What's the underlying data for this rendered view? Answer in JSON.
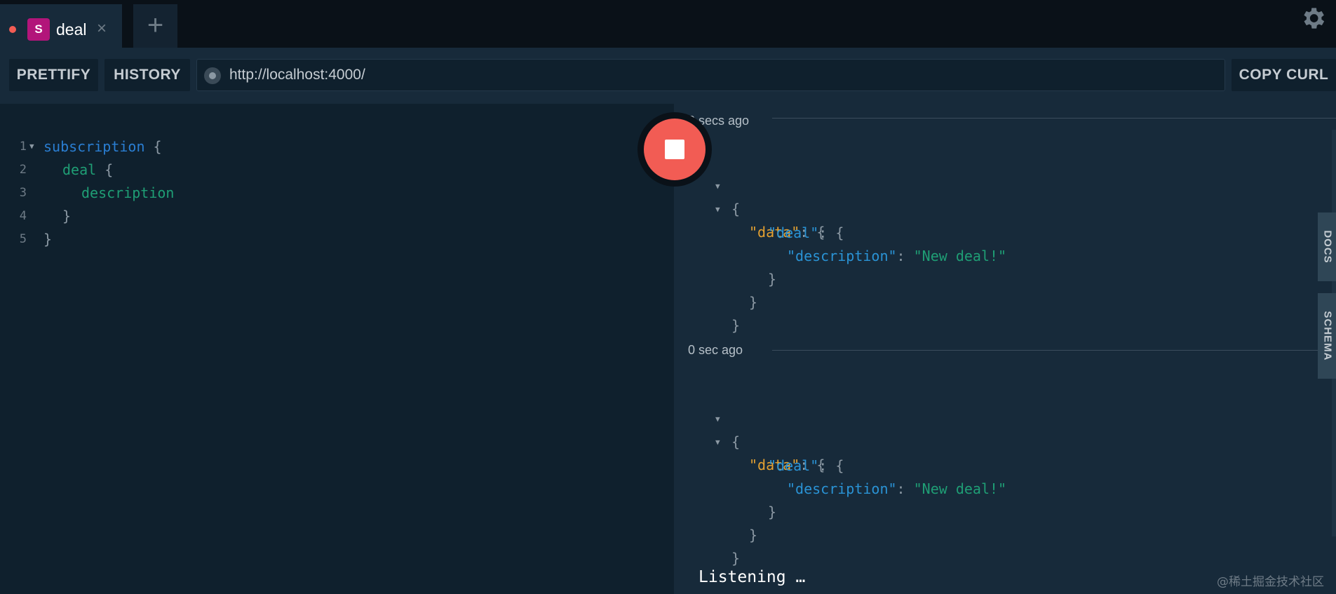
{
  "tabs": [
    {
      "badge": "S",
      "label": "deal",
      "close": "×"
    }
  ],
  "tab_add": "+",
  "icons": {
    "settings": "gear-icon",
    "close": "close-icon",
    "add": "plus-icon",
    "stop": "stop-icon"
  },
  "toolbar": {
    "prettify_label": "PRETTIFY",
    "history_label": "HISTORY",
    "url": "http://localhost:4000/",
    "copy_curl_label": "COPY CURL"
  },
  "editor": {
    "lines": [
      {
        "num": "1",
        "text": "subscription",
        "suffix": " {"
      },
      {
        "num": "2",
        "text": "deal",
        "suffix": " {"
      },
      {
        "num": "3",
        "text": "description",
        "suffix": ""
      },
      {
        "num": "4",
        "text": "",
        "suffix": "}"
      },
      {
        "num": "5",
        "text": "",
        "suffix": "}"
      }
    ]
  },
  "results": {
    "entries": [
      {
        "time": "0 secs ago",
        "open": "{",
        "data_key": "\"data\"",
        "deal_key": "\"deal\"",
        "desc_key": "\"description\"",
        "desc_value": "\"New deal!\"",
        "colon": ": ",
        "brace_open": "{",
        "brace_close": "}"
      },
      {
        "time": "0 sec ago",
        "open": "{",
        "data_key": "\"data\"",
        "deal_key": "\"deal\"",
        "desc_key": "\"description\"",
        "desc_value": "\"New deal!\"",
        "colon": ": ",
        "brace_open": "{",
        "brace_close": "}"
      }
    ],
    "status": "Listening …"
  },
  "side_tabs": {
    "docs": "DOCS",
    "schema": "SCHEMA"
  },
  "watermark": "@稀土掘金技术社区",
  "colors": {
    "accent_red": "#f25c54",
    "badge": "#b2157a",
    "keyword": "#2a7ed2",
    "field": "#1f9e75",
    "json_key_top": "#e3a031"
  }
}
